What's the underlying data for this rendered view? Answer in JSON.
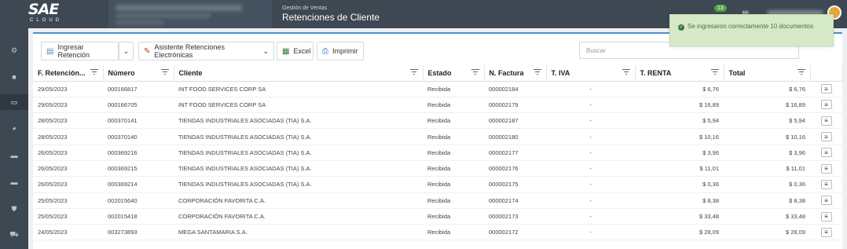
{
  "brand": {
    "name": "SAE",
    "sub": "CLOUD"
  },
  "header": {
    "crumb": "Gestión de Ventas",
    "title": "Retenciones de Cliente",
    "notification_count": "13"
  },
  "toolbar": {
    "add_label": "Ingresar Retención",
    "wizard_label": "Asistente Retenciones Electrónicas",
    "excel_label": "Excel",
    "print_label": "Imprimir",
    "search_placeholder": "Buscar"
  },
  "toast": {
    "message": "Se ingresaron correctamente 10 documentos"
  },
  "table": {
    "columns": [
      "F. Retención...",
      "Número",
      "Cliente",
      "Estado",
      "N. Factura",
      "T. IVA",
      "T. RENTA",
      "Total"
    ],
    "rows": [
      {
        "fecha": "29/05/2023",
        "numero": "000166817",
        "cliente": "INT FOOD SERVICES CORP SA",
        "estado": "Recibida",
        "factura": "000002184",
        "iva": "-",
        "renta": "$ 6,76",
        "total": "$ 6,76"
      },
      {
        "fecha": "29/05/2023",
        "numero": "000166705",
        "cliente": "INT FOOD SERVICES CORP SA",
        "estado": "Recibida",
        "factura": "000002179",
        "iva": "-",
        "renta": "$ 16,89",
        "total": "$ 16,89"
      },
      {
        "fecha": "28/05/2023",
        "numero": "000370141",
        "cliente": "TIENDAS INDUSTRIALES ASOCIADAS (TIA) S.A.",
        "estado": "Recibida",
        "factura": "000002187",
        "iva": "-",
        "renta": "$ 5,94",
        "total": "$ 5,94"
      },
      {
        "fecha": "28/05/2023",
        "numero": "000370140",
        "cliente": "TIENDAS INDUSTRIALES ASOCIADAS (TIA) S.A.",
        "estado": "Recibida",
        "factura": "000002180",
        "iva": "-",
        "renta": "$ 10,16",
        "total": "$ 10,16"
      },
      {
        "fecha": "26/05/2023",
        "numero": "000369216",
        "cliente": "TIENDAS INDUSTRIALES ASOCIADAS (TIA) S.A.",
        "estado": "Recibida",
        "factura": "000002177",
        "iva": "-",
        "renta": "$ 3,96",
        "total": "$ 3,96"
      },
      {
        "fecha": "26/05/2023",
        "numero": "000369215",
        "cliente": "TIENDAS INDUSTRIALES ASOCIADAS (TIA) S.A.",
        "estado": "Recibida",
        "factura": "000002176",
        "iva": "-",
        "renta": "$ 11,01",
        "total": "$ 11,01"
      },
      {
        "fecha": "26/05/2023",
        "numero": "000369214",
        "cliente": "TIENDAS INDUSTRIALES ASOCIADAS (TIA) S.A.",
        "estado": "Recibida",
        "factura": "000002175",
        "iva": "-",
        "renta": "$ 0,36",
        "total": "$ 0,36"
      },
      {
        "fecha": "25/05/2023",
        "numero": "002015640",
        "cliente": "CORPORACIÓN FAVORITA C.A.",
        "estado": "Recibida",
        "factura": "000002174",
        "iva": "-",
        "renta": "$ 8,38",
        "total": "$ 8,38"
      },
      {
        "fecha": "25/05/2023",
        "numero": "002015418",
        "cliente": "CORPORACIÓN FAVORITA C.A.",
        "estado": "Recibida",
        "factura": "000002173",
        "iva": "-",
        "renta": "$ 33,48",
        "total": "$ 33,48"
      },
      {
        "fecha": "24/05/2023",
        "numero": "003273893",
        "cliente": "MEGA SANTAMARIA S.A.",
        "estado": "Recibida",
        "factura": "000002172",
        "iva": "-",
        "renta": "$ 28,09",
        "total": "$ 28,09"
      }
    ]
  }
}
